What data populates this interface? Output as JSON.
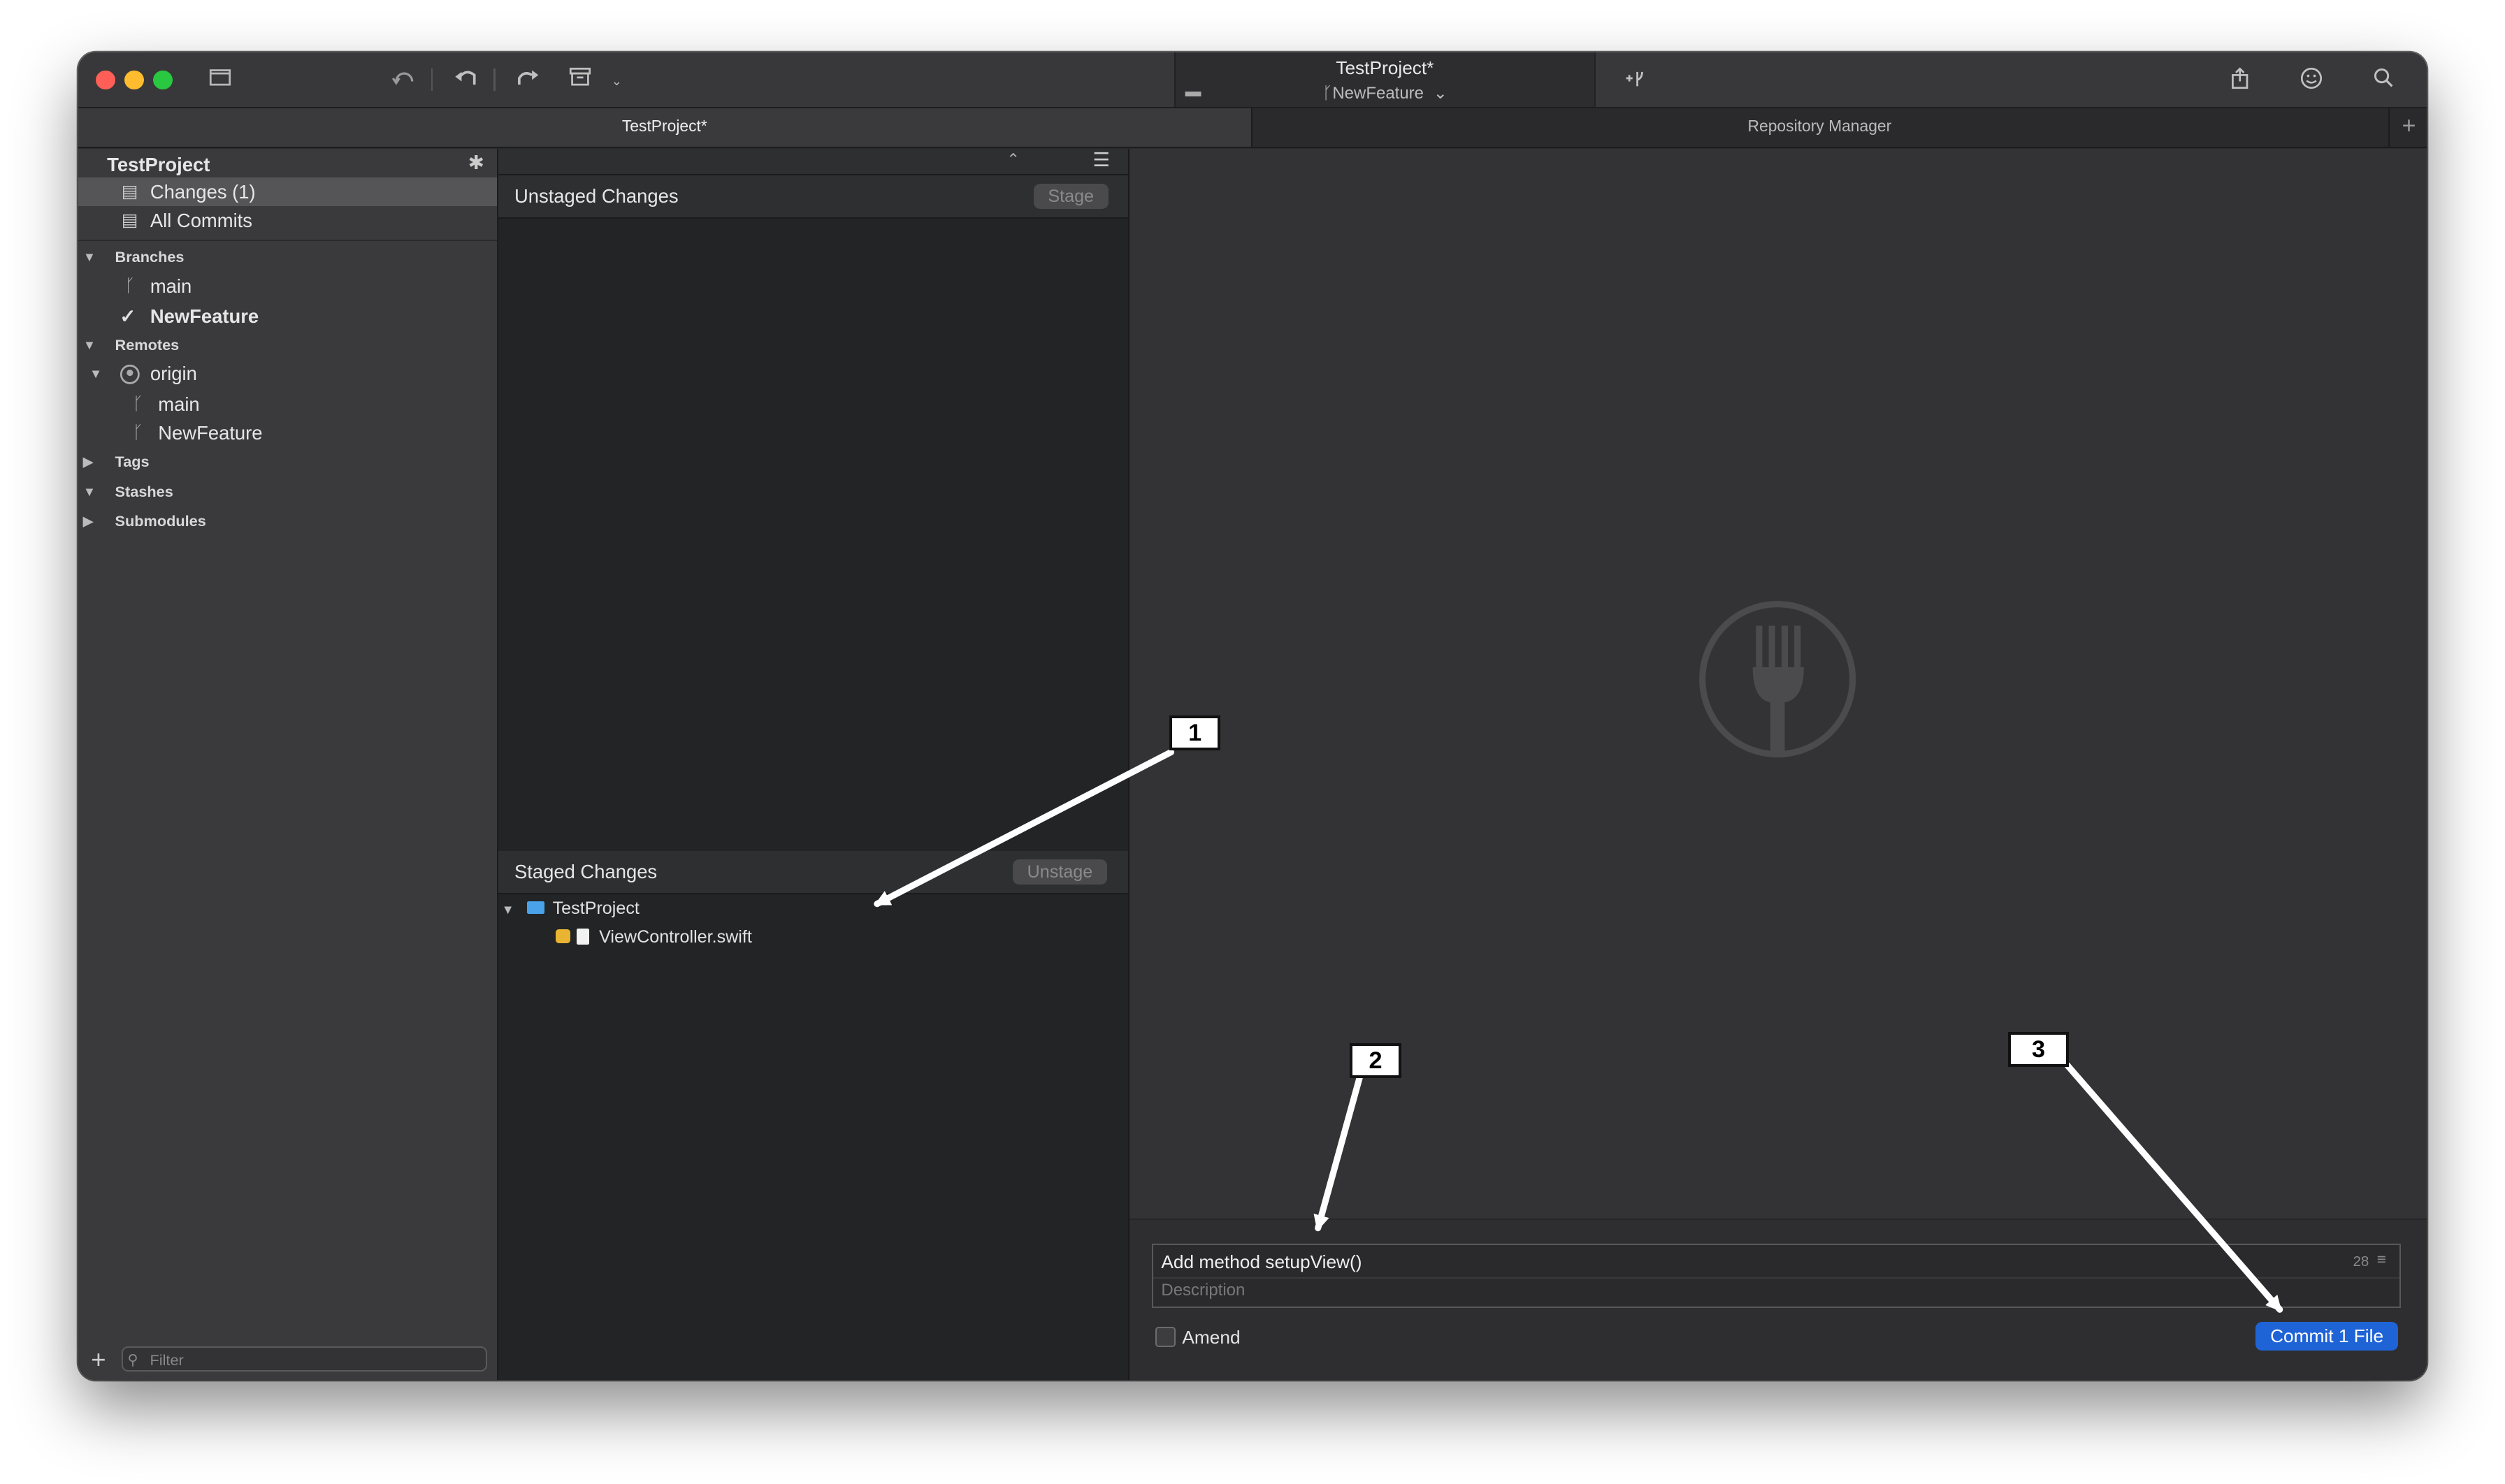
{
  "window": {
    "title_project": "TestProject*",
    "title_branch": "NewFeature",
    "tabs": [
      {
        "label": "TestProject*"
      },
      {
        "label": "Repository Manager"
      }
    ],
    "tab_plus": "+"
  },
  "sidebar": {
    "repo_name": "TestProject",
    "changes": "Changes (1)",
    "all_commits": "All Commits",
    "branches_header": "Branches",
    "branches": [
      "main",
      "NewFeature"
    ],
    "remotes_header": "Remotes",
    "remote_name": "origin",
    "remote_branches": [
      "main",
      "NewFeature"
    ],
    "tags_header": "Tags",
    "stashes_header": "Stashes",
    "submodules_header": "Submodules",
    "filter_placeholder": "Filter",
    "add": "+"
  },
  "middle": {
    "unstaged_header": "Unstaged Changes",
    "stage_button": "Stage",
    "staged_header": "Staged Changes",
    "unstage_button": "Unstage",
    "tree_folder": "TestProject",
    "tree_file": "ViewController.swift"
  },
  "commit": {
    "message": "Add method setupView()",
    "char_count": "28",
    "description_placeholder": "Description",
    "amend_label": "Amend",
    "commit_button": "Commit 1 File"
  },
  "callouts": [
    "1",
    "2",
    "3"
  ],
  "colors": {
    "accent": "#1f64d6",
    "modified_badge": "#e8b431",
    "folder": "#4aa3e8"
  }
}
